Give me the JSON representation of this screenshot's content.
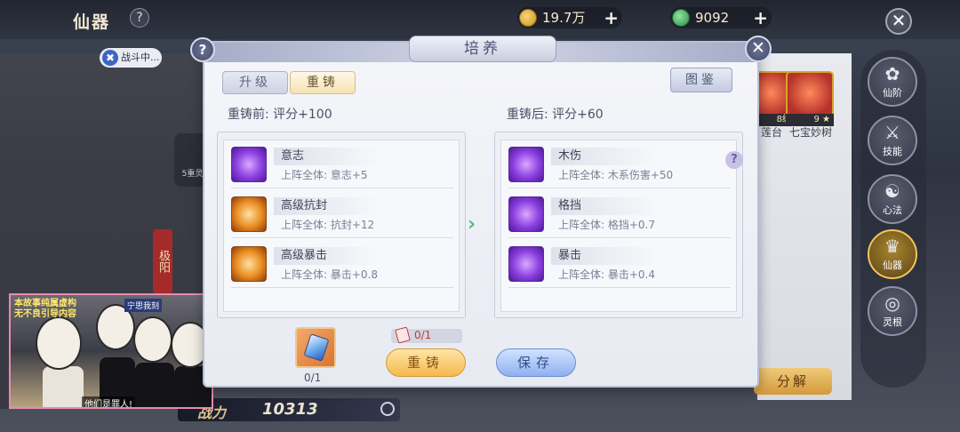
{
  "background": {
    "title": "仙器",
    "help": "?",
    "currency": {
      "gold": "19.7万",
      "jade": "9092",
      "plus": "+"
    },
    "close": "✕",
    "battle_status": "战斗中...",
    "side_tag": "极阳",
    "stage_label": "5重灵根",
    "items": [
      {
        "name": "莲台",
        "level": "8级"
      },
      {
        "name": "七宝妙树",
        "level": "9 ★"
      }
    ],
    "sidebar": [
      {
        "label": "仙阶",
        "glyph": "✿"
      },
      {
        "label": "技能",
        "glyph": "⚔"
      },
      {
        "label": "心法",
        "glyph": "☯"
      },
      {
        "label": "仙器",
        "glyph": "♛"
      },
      {
        "label": "灵根",
        "glyph": "◎"
      }
    ],
    "disassemble": "分解",
    "power": {
      "label": "战力",
      "value": "10313"
    },
    "video": {
      "caption_top": "本故事纯属虚构\n无不良引导内容",
      "caption_bottom": "他们是罪人!",
      "sign": "宁思我刻"
    }
  },
  "modal": {
    "title": "培养",
    "help": "?",
    "close": "✕",
    "tabs": [
      "升级",
      "重铸"
    ],
    "atlas_button": "图鉴",
    "before": {
      "score_label": "重铸前: 评分+100",
      "stats": [
        {
          "name": "意志",
          "desc": "上阵全体: 意志+5",
          "color": "purple"
        },
        {
          "name": "高级抗封",
          "desc": "上阵全体: 抗封+12",
          "color": "orange"
        },
        {
          "name": "高级暴击",
          "desc": "上阵全体: 暴击+0.8",
          "color": "orange"
        }
      ]
    },
    "after": {
      "score_label": "重铸后: 评分+60",
      "stats": [
        {
          "name": "木伤",
          "desc": "上阵全体: 木系伤害+50",
          "color": "purple"
        },
        {
          "name": "格挡",
          "desc": "上阵全体: 格挡+0.7",
          "color": "purple"
        },
        {
          "name": "暴击",
          "desc": "上阵全体: 暴击+0.4",
          "color": "purple"
        }
      ],
      "help": "?"
    },
    "arrow": "›",
    "material_count": "0/1",
    "cost": "0/1",
    "recast_button": "重铸",
    "save_button": "保存"
  }
}
